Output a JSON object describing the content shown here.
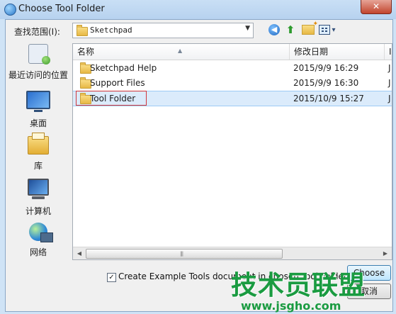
{
  "window": {
    "title": "Choose Tool Folder",
    "close_glyph": "✕"
  },
  "toolbar": {
    "look_in_label": "查找范围(I):",
    "look_in_value": "Sketchpad",
    "combo_arrow": "▼",
    "back_glyph": "◀",
    "up_glyph": "⬆",
    "view_menu_glyph": "▾",
    "icons": [
      "back-icon",
      "up-folder-icon",
      "new-folder-icon",
      "view-menu-icon"
    ]
  },
  "places": [
    {
      "label": "最近访问的位置",
      "icon": "recent-places-icon"
    },
    {
      "label": "桌面",
      "icon": "desktop-icon"
    },
    {
      "label": "库",
      "icon": "libraries-icon"
    },
    {
      "label": "计算机",
      "icon": "computer-icon"
    },
    {
      "label": "网络",
      "icon": "network-icon"
    }
  ],
  "file_list": {
    "columns": [
      "名称",
      "修改日期",
      "I"
    ],
    "sort_glyph": "▲",
    "rows": [
      {
        "name": "Sketchpad Help",
        "date": "2015/9/9 16:29",
        "extra": "J",
        "selected": false
      },
      {
        "name": "Support Files",
        "date": "2015/9/9 16:30",
        "extra": "J",
        "selected": false
      },
      {
        "name": "Tool Folder",
        "date": "2015/10/9 15:27",
        "extra": "J",
        "selected": true
      }
    ],
    "scroll_left_glyph": "◀",
    "scroll_right_glyph": "▶",
    "scroll_grip": "|||"
  },
  "bottom": {
    "checkbox_checked": true,
    "checkbox_glyph": "✓",
    "checkbox_label": "Create Example Tools document in chosen Tool Folder",
    "ok_label": "Choose",
    "cancel_label": "取消"
  },
  "watermark": {
    "text": "技术员联盟",
    "url": "www.jsgho.com"
  },
  "colors": {
    "selection": "#dbebfb",
    "highlight_box": "#d1363a",
    "watermark": "#1a9b41"
  }
}
